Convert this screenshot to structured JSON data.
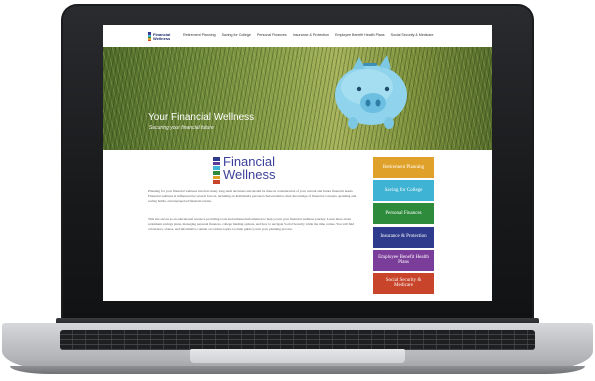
{
  "nav": {
    "logo": {
      "line1": "Financial",
      "line2": "Wellness"
    },
    "items": [
      "Retirement Planning",
      "Saving for College",
      "Personal Finances",
      "Insurance & Protection",
      "Employee Benefit Health Plans",
      "Social Security & Medicare"
    ]
  },
  "hero": {
    "title": "Your Financial Wellness",
    "subtitle": "Securing your financial future"
  },
  "logo": {
    "line1": "Financial",
    "line2": "Wellness",
    "bar_colors": [
      "#2e3a8c",
      "#5b3d99",
      "#3fb3d3",
      "#2e8b3c",
      "#e0a12a",
      "#c8452b"
    ]
  },
  "body": {
    "paragraph1": "Planning for your financial wellness involves many long-term decisions and should be done in consideration of your current and future financial needs. Financial wellness is influenced by several factors, including an individual's personal characteristics, their knowledge of financial concepts, spending and saving habits, and unexpected financial events.",
    "paragraph2": "This site serves as an educational resource providing tools and unbiased information to help you in your financial wellness journey. Learn more about retirement savings plans, managing personal finances, college funding options, and how to navigate Social Security while the time comes. You will find calculators, videos, and informative content on various topics too help guide you in your planning process."
  },
  "buttons": [
    {
      "label": "Retirement Planning",
      "color": "#e0a12a"
    },
    {
      "label": "Saving for College",
      "color": "#3fb3d3"
    },
    {
      "label": "Personal Finances",
      "color": "#2e8b3c"
    },
    {
      "label": "Insurance & Protection",
      "color": "#2e3a8c"
    },
    {
      "label": "Employee Benefit Health Plans",
      "color": "#7a3d9a"
    },
    {
      "label": "Social Security & Medicare",
      "color": "#c8452b"
    }
  ]
}
